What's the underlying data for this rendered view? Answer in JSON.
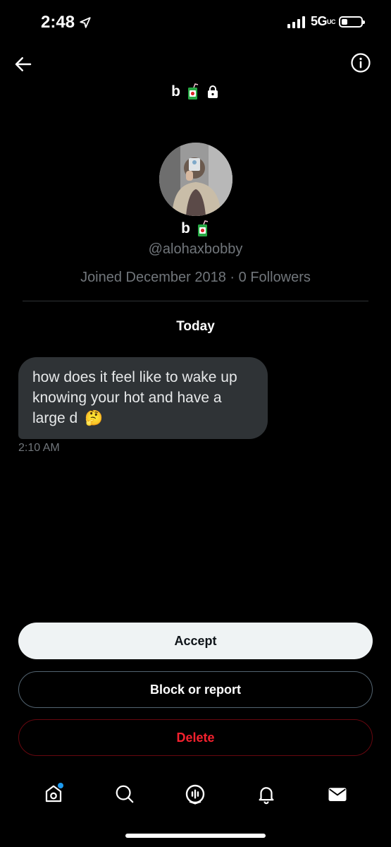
{
  "status": {
    "time": "2:48",
    "network": "5G",
    "network_superscript": "UC"
  },
  "header": {
    "name": "b"
  },
  "profile": {
    "name": "b",
    "handle": "@alohaxbobby",
    "joined": "Joined December 2018",
    "separator": "·",
    "followers": "0 Followers"
  },
  "conversation": {
    "day_label": "Today",
    "messages": [
      {
        "text": "how does it feel like to wake up knowing your hot and have a large d",
        "emoji": "🤔",
        "time": "2:10 AM"
      }
    ]
  },
  "actions": {
    "accept": "Accept",
    "block": "Block or report",
    "delete": "Delete"
  },
  "icons": [
    "back-arrow-icon",
    "info-icon",
    "juicebox-emoji-icon",
    "lock-icon",
    "home-icon",
    "search-icon",
    "spaces-icon",
    "notifications-icon",
    "messages-icon"
  ],
  "colors": {
    "background": "#000000",
    "bubble": "#2f3336",
    "muted": "#71767b",
    "accent": "#1d9bf0",
    "danger": "#f4212e"
  }
}
